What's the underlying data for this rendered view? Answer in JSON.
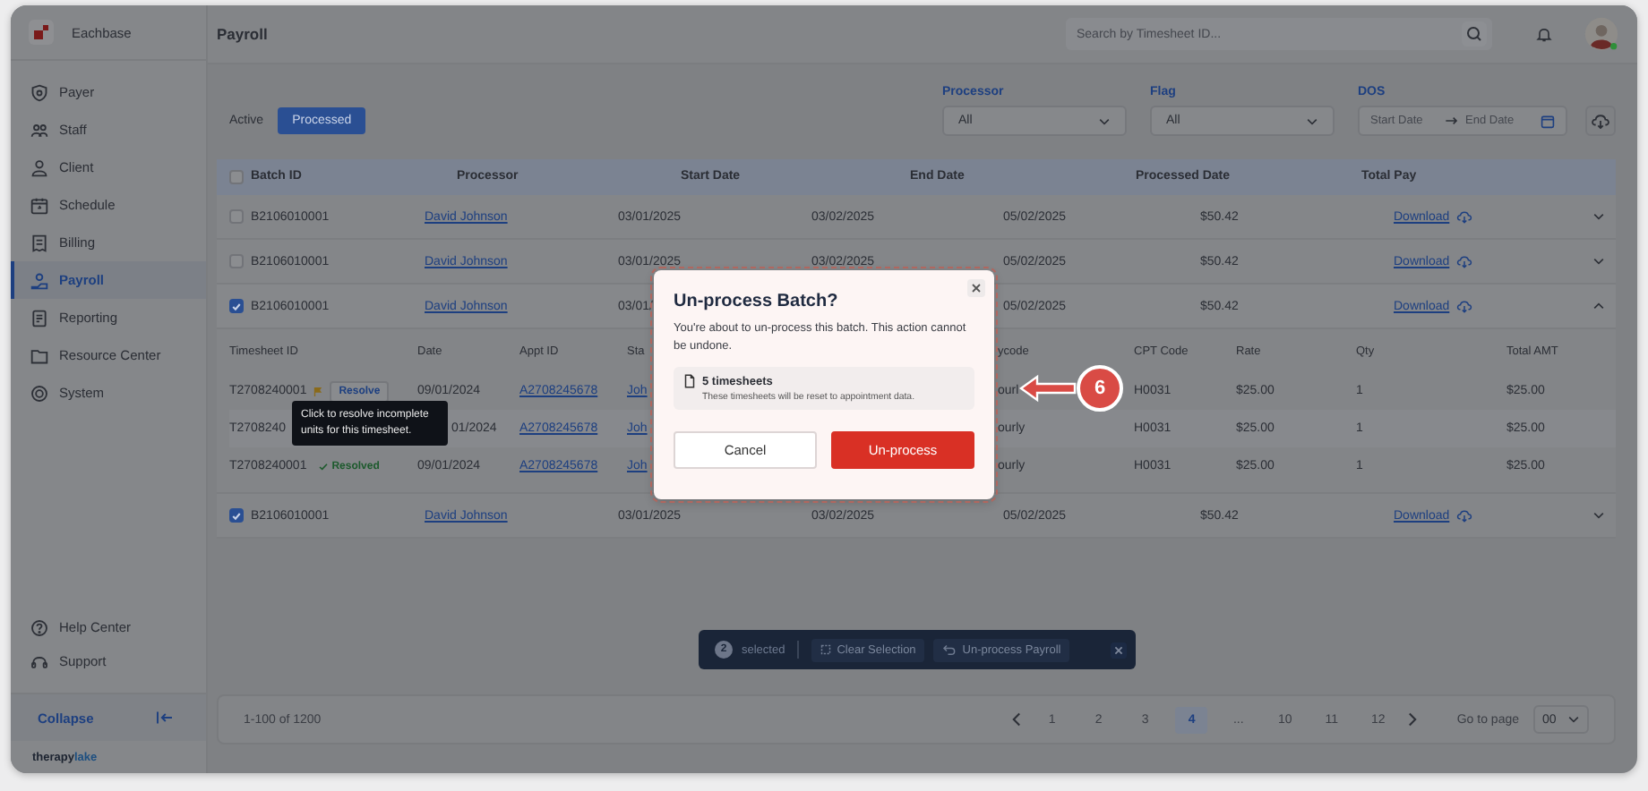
{
  "app": {
    "name": "Eachbase",
    "brand": [
      "therapy",
      "lake"
    ]
  },
  "sidebar": {
    "items": [
      {
        "label": "Payer",
        "kind": "shield",
        "selected": false
      },
      {
        "label": "Staff",
        "kind": "people",
        "selected": false
      },
      {
        "label": "Client",
        "kind": "person",
        "selected": false
      },
      {
        "label": "Schedule",
        "kind": "calendar",
        "selected": false
      },
      {
        "label": "Billing",
        "kind": "receipt",
        "selected": false
      },
      {
        "label": "Payroll",
        "kind": "payroll",
        "selected": true
      },
      {
        "label": "Reporting",
        "kind": "report",
        "selected": false
      },
      {
        "label": "Resource Center",
        "kind": "folder",
        "selected": false
      },
      {
        "label": "System",
        "kind": "system",
        "selected": false
      }
    ],
    "footer_items": [
      {
        "label": "Help Center",
        "kind": "help"
      },
      {
        "label": "Support",
        "kind": "headset"
      }
    ],
    "collapse": "Collapse"
  },
  "header": {
    "title": "Payroll",
    "search_placeholder": "Search by Timesheet ID..."
  },
  "filters": {
    "tabs": [
      {
        "label": "Active",
        "selected": false
      },
      {
        "label": "Processed",
        "selected": true
      }
    ],
    "selects": [
      {
        "label": "Processor",
        "value": "All"
      },
      {
        "label": "Flag",
        "value": "All"
      }
    ],
    "date": {
      "label": "DOS",
      "start_placeholder": "Start Date",
      "end_placeholder": "End Date"
    }
  },
  "table": {
    "all_checked": false,
    "columns": [
      "Batch ID",
      "Processor",
      "Start Date",
      "End Date",
      "Processed Date",
      "Total Pay"
    ],
    "rows": [
      {
        "checked": false,
        "batch_id": "B2106010001",
        "processor": "David Johnson",
        "start_date": "03/01/2025",
        "end_date": "03/02/2025",
        "processed_date": "05/02/2025",
        "total_pay": "$50.42",
        "link": "Download",
        "expanded": false
      },
      {
        "checked": false,
        "batch_id": "B2106010001",
        "processor": "David Johnson",
        "start_date": "03/01/2025",
        "end_date": "03/02/2025",
        "processed_date": "05/02/2025",
        "total_pay": "$50.42",
        "link": "Download",
        "expanded": false
      },
      {
        "checked": true,
        "batch_id": "B2106010001",
        "processor": "David Johnson",
        "start_date": "03/01/",
        "processed_date": "05/02/2025",
        "total_pay": "$50.42",
        "link": "Download",
        "expanded": true,
        "detail": {
          "columns": [
            "Timesheet ID",
            "Date",
            "Appt ID",
            "Sta",
            "ycode",
            "CPT Code",
            "Rate",
            "Qty",
            "Total AMT"
          ],
          "rows": [
            {
              "timesheet_id": "T2708240001",
              "kind": "flag",
              "action": "Resolve",
              "date": "09/01/2024",
              "appt_id": "A2708245678",
              "start": "Joh",
              "paycode": "ourl",
              "cpt": "H0031",
              "rate": "$25.00",
              "qty": "1",
              "total": "$25.00"
            },
            {
              "timesheet_id": "T2708240",
              "date": "01/2024",
              "appt_id": "A2708245678",
              "start": "Joh",
              "paycode": "ourly",
              "cpt": "H0031",
              "rate": "$25.00",
              "qty": "1",
              "total": "$25.00"
            },
            {
              "timesheet_id": "T2708240001",
              "kind": "resolved",
              "status_label": "Resolved",
              "date": "09/01/2024",
              "appt_id": "A2708245678",
              "start": "Joh",
              "paycode": "ourly",
              "cpt": "H0031",
              "rate": "$25.00",
              "qty": "1",
              "total": "$25.00"
            }
          ]
        }
      },
      {
        "checked": true,
        "batch_id": "B2106010001",
        "processor": "David Johnson",
        "start_date": "03/01/2025",
        "end_date": "03/02/2025",
        "processed_date": "05/02/2025",
        "total_pay": "$50.42",
        "link": "Download",
        "expanded": false
      }
    ]
  },
  "tooltip": "Click to resolve incomplete units for this timesheet.",
  "modal": {
    "title": "Un-process Batch?",
    "body": "You're about to un-process this batch. This action cannot be undone.",
    "info_title": "5 timesheets",
    "info_note": "These timesheets will be reset to appointment data.",
    "cancel": "Cancel",
    "confirm": "Un-process"
  },
  "callout": "6",
  "selection_bar": {
    "count": "2",
    "label": "selected",
    "actions": [
      {
        "label": "Clear Selection",
        "kind": "clear"
      },
      {
        "label": "Un-process Payroll",
        "kind": "undo"
      }
    ]
  },
  "pagination": {
    "range": "1-100 of 1200",
    "pages": [
      {
        "label": "1",
        "selected": false
      },
      {
        "label": "2",
        "selected": false
      },
      {
        "label": "3",
        "selected": false
      },
      {
        "label": "4",
        "selected": true
      },
      {
        "label": "...",
        "selected": false
      },
      {
        "label": "10",
        "selected": false
      },
      {
        "label": "11",
        "selected": false
      },
      {
        "label": "12",
        "selected": false
      }
    ],
    "goto_label": "Go to page",
    "goto_value": "00"
  }
}
